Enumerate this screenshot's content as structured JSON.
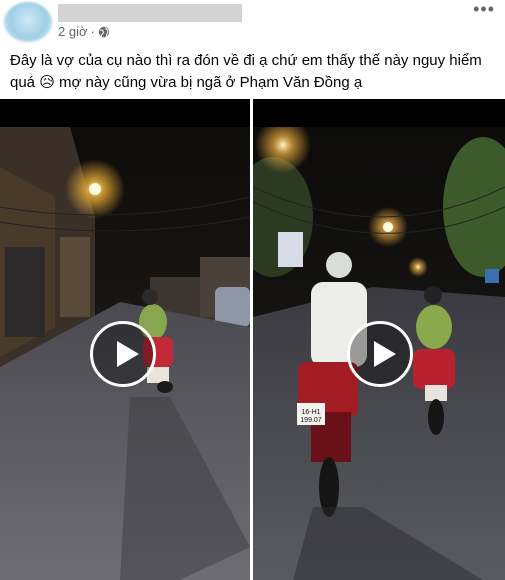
{
  "post": {
    "time": "2 giờ",
    "dot": "·",
    "more": "•••",
    "caption_line1": "Đây là vợ của cụ nào thì ra đón về đi ạ chứ em thấy thế này nguy hiểm",
    "caption_line2": "quá 😥 mợ này cũng vừa bị ngã ở Phạm Văn Đồng ạ",
    "privacy_icon": "globe-icon"
  },
  "videos": [
    {
      "name": "video-left",
      "play_icon": "play-icon"
    },
    {
      "name": "video-right",
      "play_icon": "play-icon",
      "plate_line1": "16-H1",
      "plate_line2": "199.07"
    }
  ]
}
